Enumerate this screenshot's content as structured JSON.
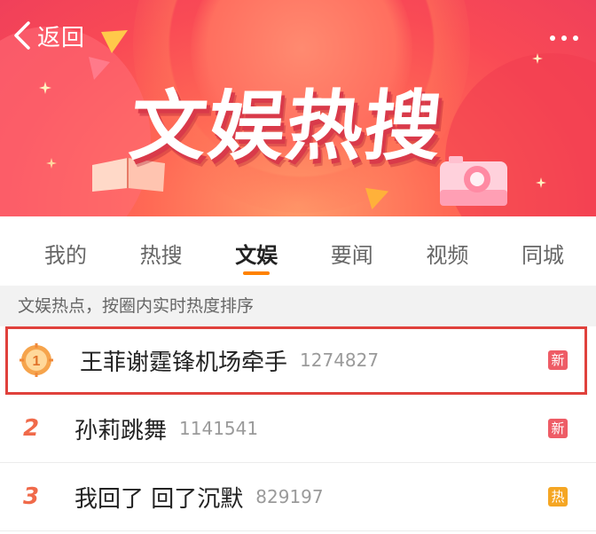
{
  "header": {
    "back_label": "返回",
    "title": "文娱热搜"
  },
  "tabs": [
    {
      "label": "我的"
    },
    {
      "label": "热搜"
    },
    {
      "label": "文娱",
      "active": true
    },
    {
      "label": "要闻"
    },
    {
      "label": "视频"
    },
    {
      "label": "同城"
    }
  ],
  "info": "文娱热点，按圈内实时热度排序",
  "list": [
    {
      "rank": "1",
      "title": "王菲谢霆锋机场牵手",
      "count": "1274827",
      "tag": "新",
      "tag_color": "#ee5c66"
    },
    {
      "rank": "2",
      "title": "孙莉跳舞",
      "count": "1141541",
      "tag": "新",
      "tag_color": "#ee5c66"
    },
    {
      "rank": "3",
      "title": "我回了 回了沉默",
      "count": "829197",
      "tag": "热",
      "tag_color": "#f5a623"
    }
  ],
  "colors": {
    "accent": "#ff8200",
    "highlight_border": "#e0413c",
    "rank_text": "#f06a4a"
  }
}
